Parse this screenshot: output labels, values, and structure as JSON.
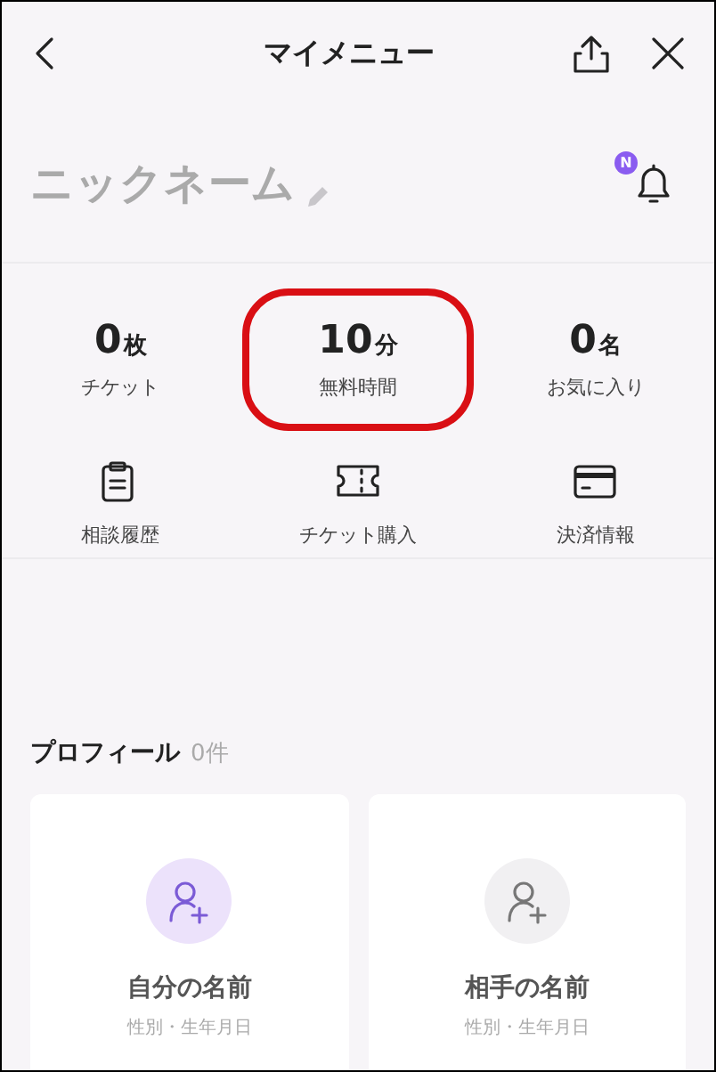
{
  "header": {
    "title": "マイメニュー"
  },
  "profile_row": {
    "nickname": "ニックネーム",
    "notification_badge": "N"
  },
  "stats": [
    {
      "value": "0",
      "unit": "枚",
      "label": "チケット",
      "highlighted": false
    },
    {
      "value": "10",
      "unit": "分",
      "label": "無料時間",
      "highlighted": true
    },
    {
      "value": "0",
      "unit": "名",
      "label": "お気に入り",
      "highlighted": false
    }
  ],
  "shortcuts": [
    {
      "kind": "clipboard",
      "label": "相談履歴"
    },
    {
      "kind": "ticket",
      "label": "チケット購入"
    },
    {
      "kind": "card",
      "label": "決済情報"
    }
  ],
  "profiles": {
    "title": "プロフィール",
    "count": "0件",
    "cards": [
      {
        "kind": "self",
        "name": "自分の名前",
        "detail": "性別・生年月日"
      },
      {
        "kind": "other",
        "name": "相手の名前",
        "detail": "性別・生年月日"
      }
    ]
  }
}
